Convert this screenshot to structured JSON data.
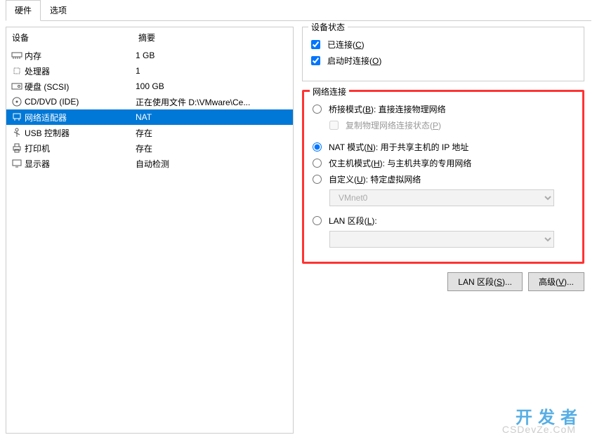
{
  "tabs": {
    "hardware": "硬件",
    "options": "选项"
  },
  "headers": {
    "device": "设备",
    "summary": "摘要"
  },
  "devices": [
    {
      "name": "内存",
      "summary": "1 GB",
      "icon": "memory"
    },
    {
      "name": "处理器",
      "summary": "1",
      "icon": "cpu"
    },
    {
      "name": "硬盘 (SCSI)",
      "summary": "100 GB",
      "icon": "hdd"
    },
    {
      "name": "CD/DVD (IDE)",
      "summary": "正在使用文件 D:\\VMware\\Ce...",
      "icon": "cd"
    },
    {
      "name": "网络适配器",
      "summary": "NAT",
      "icon": "net"
    },
    {
      "name": "USB 控制器",
      "summary": "存在",
      "icon": "usb"
    },
    {
      "name": "打印机",
      "summary": "存在",
      "icon": "printer"
    },
    {
      "name": "显示器",
      "summary": "自动检测",
      "icon": "display"
    }
  ],
  "deviceStatus": {
    "legend": "设备状态",
    "connected": {
      "label": "已连接(",
      "key": "C",
      "suffix": ")",
      "checked": true
    },
    "connectOnStart": {
      "label": "启动时连接(",
      "key": "O",
      "suffix": ")",
      "checked": true
    }
  },
  "netConn": {
    "legend": "网络连接",
    "bridged": {
      "label": "桥接模式(",
      "key": "B",
      "suffix": "): 直接连接物理网络",
      "checked": false
    },
    "replicate": {
      "label": "复制物理网络连接状态(",
      "key": "P",
      "suffix": ")",
      "disabled": true
    },
    "nat": {
      "label": "NAT 模式(",
      "key": "N",
      "suffix": "): 用于共享主机的 IP 地址",
      "checked": true
    },
    "hostOnly": {
      "label": "仅主机模式(",
      "key": "H",
      "suffix": "): 与主机共享的专用网络",
      "checked": false
    },
    "custom": {
      "label": "自定义(",
      "key": "U",
      "suffix": "): 特定虚拟网络",
      "checked": false
    },
    "customSelectValue": "VMnet0",
    "lanSeg": {
      "label": "LAN 区段(",
      "key": "L",
      "suffix": "):",
      "checked": false
    },
    "lanSelectValue": ""
  },
  "buttons": {
    "lanSegments": {
      "label": "LAN 区段(",
      "key": "S",
      "suffix": ")..."
    },
    "advanced": {
      "label": "高级(",
      "key": "V",
      "suffix": ")..."
    }
  },
  "watermark": {
    "main": "开发者",
    "sub": "CSDevZe.CoM"
  }
}
